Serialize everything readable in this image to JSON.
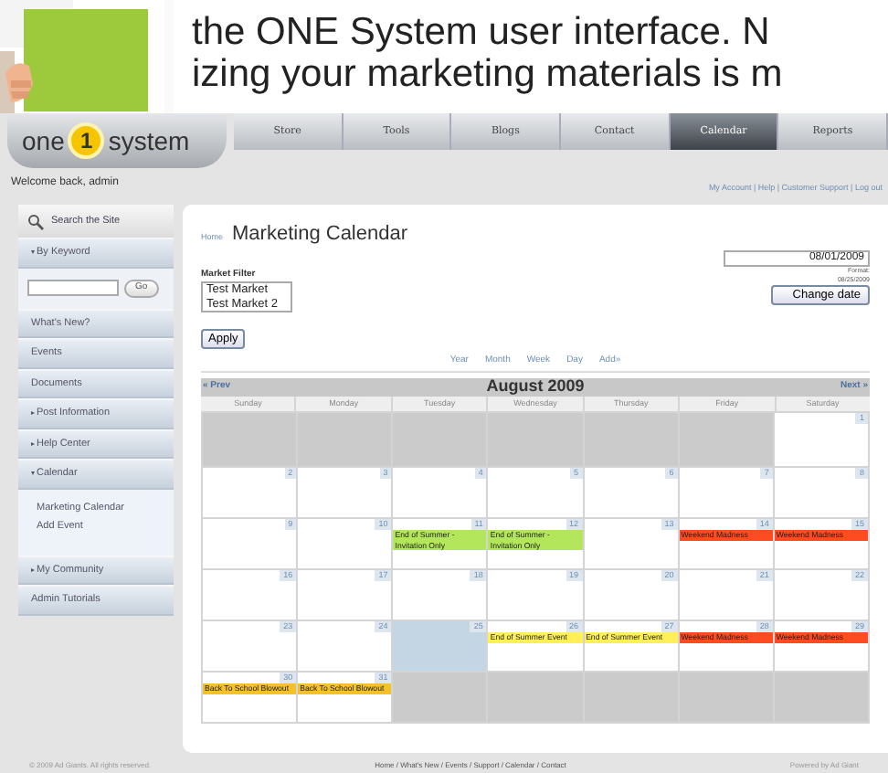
{
  "caption": {
    "lines": [
      "the ONE System user interface. N",
      "izing your marketing materials is m"
    ]
  },
  "logo": {
    "parts": [
      "one",
      "1",
      "system"
    ]
  },
  "tabs": [
    {
      "label": "Store",
      "selected": false
    },
    {
      "label": "Tools",
      "selected": false
    },
    {
      "label": "Blogs",
      "selected": false
    },
    {
      "label": "Contact",
      "selected": false
    },
    {
      "label": "Calendar",
      "selected": true
    },
    {
      "label": "Reports",
      "selected": false
    }
  ],
  "welcome": "Welcome back, admin",
  "account_links": "My Account | Help | Customer Support | Log out",
  "sidebar": {
    "search_title": "Search the Site",
    "items": [
      {
        "kind": "section",
        "label": "By Keyword",
        "expanded": true
      },
      {
        "kind": "search",
        "button": "Go"
      },
      {
        "kind": "link",
        "label": "What's New?"
      },
      {
        "kind": "link",
        "label": "Events"
      },
      {
        "kind": "link",
        "label": "Documents"
      },
      {
        "kind": "section",
        "label": "Post Information",
        "expanded": false
      },
      {
        "kind": "section",
        "label": "Help Center",
        "expanded": false
      },
      {
        "kind": "section",
        "label": "Calendar",
        "expanded": true,
        "children": [
          {
            "label": "Marketing Calendar"
          },
          {
            "label": "Add Event"
          }
        ]
      },
      {
        "kind": "section",
        "label": "My Community",
        "expanded": false
      },
      {
        "kind": "link",
        "label": "Admin Tutorials"
      }
    ]
  },
  "main": {
    "breadcrumb": "Home",
    "title": "Marketing Calendar",
    "filter": {
      "label": "Market Filter",
      "options": [
        "Test Market",
        "Test Market 2"
      ],
      "button": "Apply"
    },
    "date": {
      "value": "08/01/2009",
      "format_label": "Format:",
      "format_example": "08/25/2009",
      "button": "Change date"
    },
    "views": [
      "Year",
      "Month",
      "Week",
      "Day",
      "Add»"
    ],
    "calendar": {
      "prev": "« Prev",
      "title": "August 2009",
      "next": "Next »",
      "weekdays": [
        "Sunday",
        "Monday",
        "Tuesday",
        "Wednesday",
        "Thursday",
        "Friday",
        "Saturday"
      ],
      "weeks": [
        [
          {
            "kind": "blank"
          },
          {
            "kind": "blank"
          },
          {
            "kind": "blank"
          },
          {
            "kind": "blank"
          },
          {
            "kind": "blank"
          },
          {
            "kind": "blank"
          },
          {
            "kind": "day",
            "day": "1",
            "today": false
          }
        ],
        [
          {
            "kind": "day",
            "day": "2",
            "today": false
          },
          {
            "kind": "day",
            "day": "3",
            "today": false
          },
          {
            "kind": "day",
            "day": "4",
            "today": false
          },
          {
            "kind": "day",
            "day": "5",
            "today": false
          },
          {
            "kind": "day",
            "day": "6",
            "today": false
          },
          {
            "kind": "day",
            "day": "7",
            "today": false
          },
          {
            "kind": "day",
            "day": "8",
            "today": false
          }
        ],
        [
          {
            "kind": "day",
            "day": "9",
            "today": false
          },
          {
            "kind": "day",
            "day": "10",
            "today": false
          },
          {
            "kind": "day",
            "day": "11",
            "today": false,
            "events": [
              {
                "text": "End of Summer - Invitation Only",
                "color": "#b3e65a"
              }
            ]
          },
          {
            "kind": "day",
            "day": "12",
            "today": false,
            "events": [
              {
                "text": "End of Summer - Invitation Only",
                "color": "#b3e65a"
              }
            ]
          },
          {
            "kind": "day",
            "day": "13",
            "today": false
          },
          {
            "kind": "day",
            "day": "14",
            "today": false,
            "events": [
              {
                "text": "Weekend Madness",
                "color": "#ff4b22"
              }
            ]
          },
          {
            "kind": "day",
            "day": "15",
            "today": false,
            "events": [
              {
                "text": "Weekend Madness",
                "color": "#ff4b22"
              }
            ]
          }
        ],
        [
          {
            "kind": "day",
            "day": "16",
            "today": false
          },
          {
            "kind": "day",
            "day": "17",
            "today": false
          },
          {
            "kind": "day",
            "day": "18",
            "today": false
          },
          {
            "kind": "day",
            "day": "19",
            "today": false
          },
          {
            "kind": "day",
            "day": "20",
            "today": false
          },
          {
            "kind": "day",
            "day": "21",
            "today": false
          },
          {
            "kind": "day",
            "day": "22",
            "today": false
          }
        ],
        [
          {
            "kind": "day",
            "day": "23",
            "today": false
          },
          {
            "kind": "day",
            "day": "24",
            "today": false
          },
          {
            "kind": "day",
            "day": "25",
            "today": true
          },
          {
            "kind": "day",
            "day": "26",
            "today": false,
            "events": [
              {
                "text": "End of Summer Event",
                "color": "#fff05a"
              }
            ]
          },
          {
            "kind": "day",
            "day": "27",
            "today": false,
            "events": [
              {
                "text": "End of Summer Event",
                "color": "#fff05a"
              }
            ]
          },
          {
            "kind": "day",
            "day": "28",
            "today": false,
            "events": [
              {
                "text": "Weekend Madness",
                "color": "#ff4b22"
              }
            ]
          },
          {
            "kind": "day",
            "day": "29",
            "today": false,
            "events": [
              {
                "text": "Weekend Madness",
                "color": "#ff4b22"
              }
            ]
          }
        ],
        [
          {
            "kind": "day",
            "day": "30",
            "today": false,
            "events": [
              {
                "text": "Back To School Blowout",
                "color": "#f5c12a"
              }
            ]
          },
          {
            "kind": "day",
            "day": "31",
            "today": false,
            "events": [
              {
                "text": "Back To School Blowout",
                "color": "#f5c12a"
              }
            ]
          },
          {
            "kind": "blank"
          },
          {
            "kind": "blank"
          },
          {
            "kind": "blank"
          },
          {
            "kind": "blank"
          },
          {
            "kind": "blank"
          }
        ]
      ]
    }
  },
  "footer": {
    "copyright": "© 2009 Ad Giants. All rights reserved.",
    "links": "Home / What's New / Events / Support / Calendar / Contact",
    "powered": "Powered by Ad Giant"
  }
}
